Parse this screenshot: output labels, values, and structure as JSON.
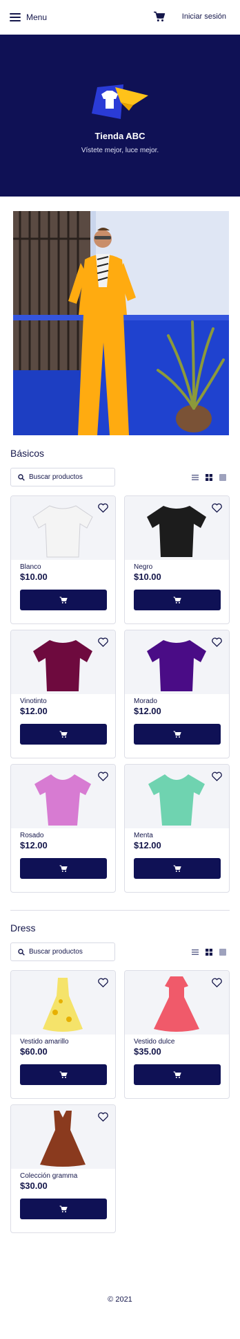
{
  "header": {
    "menu_label": "Menu",
    "cart_icon": "cart-icon",
    "login_label": "Iniciar sesión"
  },
  "hero": {
    "store_name": "Tienda ABC",
    "tagline": "Vístete mejor, luce mejor."
  },
  "sections": [
    {
      "title": "Básicos",
      "search_placeholder": "Buscar productos",
      "products": [
        {
          "name": "Blanco",
          "price": "$10.00",
          "color": "#f4f4f4"
        },
        {
          "name": "Negro",
          "price": "$10.00",
          "color": "#1c1c1c"
        },
        {
          "name": "Vinotinto",
          "price": "$12.00",
          "color": "#6e0a3e"
        },
        {
          "name": "Morado",
          "price": "$12.00",
          "color": "#4a0c86"
        },
        {
          "name": "Rosado",
          "price": "$12.00",
          "color": "#d77bd2"
        },
        {
          "name": "Menta",
          "price": "$12.00",
          "color": "#6fd3b0"
        }
      ]
    },
    {
      "title": "Dress",
      "search_placeholder": "Buscar productos",
      "products": [
        {
          "name": "Vestido amarillo",
          "price": "$60.00",
          "color": "#f5e36a"
        },
        {
          "name": "Vestido dulce",
          "price": "$35.00",
          "color": "#f05a6a"
        },
        {
          "name": "Colección gramma",
          "price": "$30.00",
          "color": "#8a3a1e"
        }
      ]
    }
  ],
  "footer": {
    "copyright": "© 2021"
  },
  "colors": {
    "primary": "#0f1155",
    "accent": "#ffc21a",
    "logo_blue": "#2a3bd6"
  }
}
